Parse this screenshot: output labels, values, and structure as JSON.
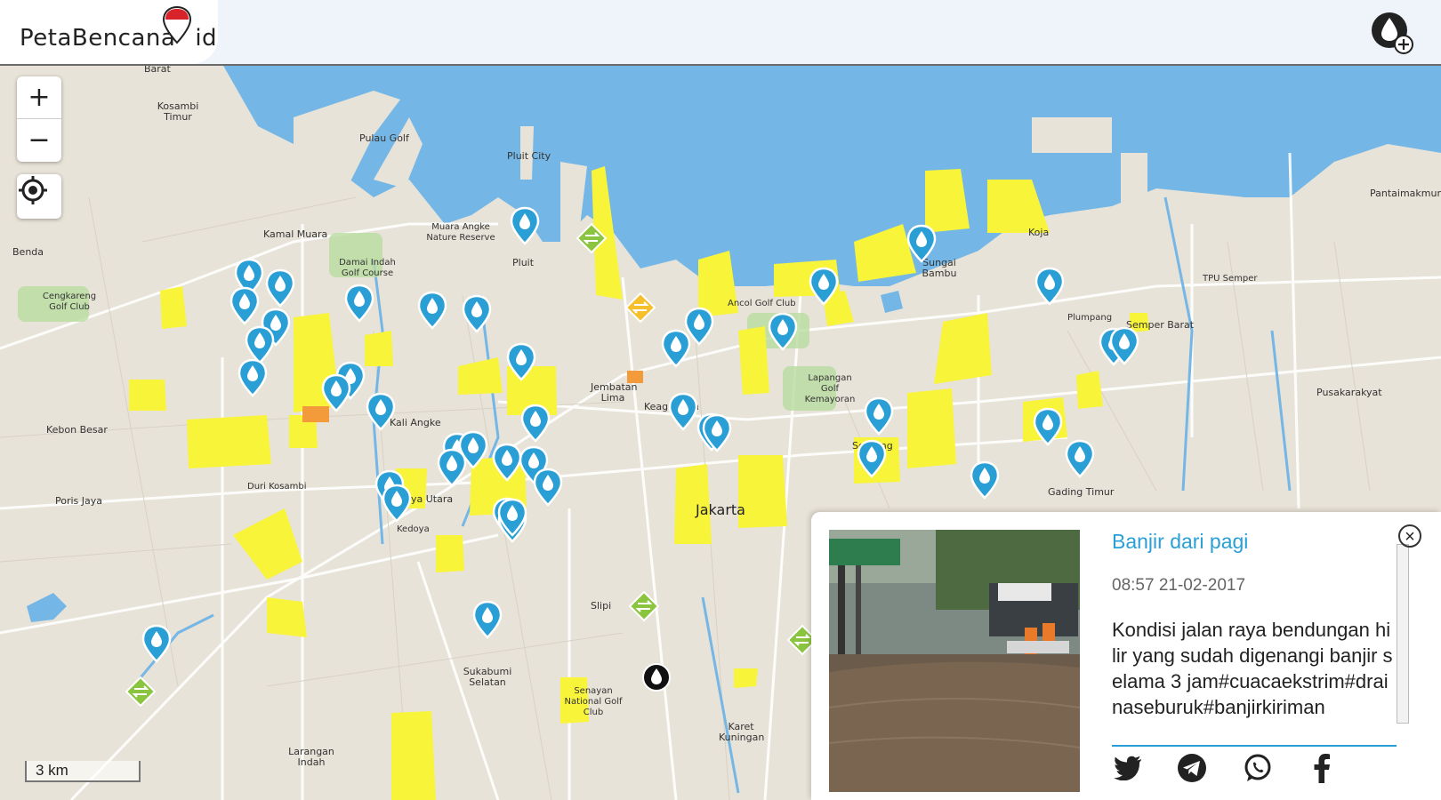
{
  "header": {
    "logo_text": "PetaBencana",
    "logo_suffix": "id",
    "add_report_icon": "water-drop-plus-icon"
  },
  "map_controls": {
    "zoom_in": "+",
    "zoom_out": "−",
    "locate_icon": "crosshair-icon",
    "scale": "3 km"
  },
  "map_labels": [
    "Barat",
    "Kosambi Timur",
    "Cengkareng Golf Club",
    "Benda",
    "Kamal Muara",
    "Kebon Besar",
    "Poris Jaya",
    "Pulau Golf",
    "Pluit City",
    "Muara Angke Nature Reserve",
    "Damai Indah Golf Course",
    "Pluit",
    "Jembatan Lima",
    "Keagungan",
    "Jakarta",
    "Slipi",
    "Sukabumi Selatan",
    "Larangan Indah",
    "Senayan National Golf Club",
    "Karet Kuningan",
    "Sungai Bambu",
    "Ancol Golf Club",
    "Lapangan Golf Kemayoran",
    "Serdang",
    "Koja",
    "Pantaimakmur",
    "TPU Semper",
    "Semper Barat",
    "Pusakarakyat",
    "Plumpang",
    "Gading Timur",
    "Duri Kosambi",
    "Kali Angke",
    "Jaya Utara",
    "Kedoya"
  ],
  "popup": {
    "title": "Banjir dari pagi",
    "time": "08:57 21-02-2017",
    "text": "Kondisi jalan raya bendungan hilir yang sudah digenangi banjir selama 3 jam#cuacaekstrim#drainaseburuk#banjirkiriman",
    "close_icon": "close-icon",
    "share_icons": [
      "twitter-icon",
      "telegram-icon",
      "whatsapp-icon",
      "facebook-icon"
    ]
  },
  "colors": {
    "water": "#74b7e6",
    "flood_area": "#f8f43a",
    "pin_blue": "#2a9fd6",
    "accent_title": "#2a9fd6",
    "pin_green": "#8bc43f",
    "pin_yellow": "#f5c02b"
  }
}
